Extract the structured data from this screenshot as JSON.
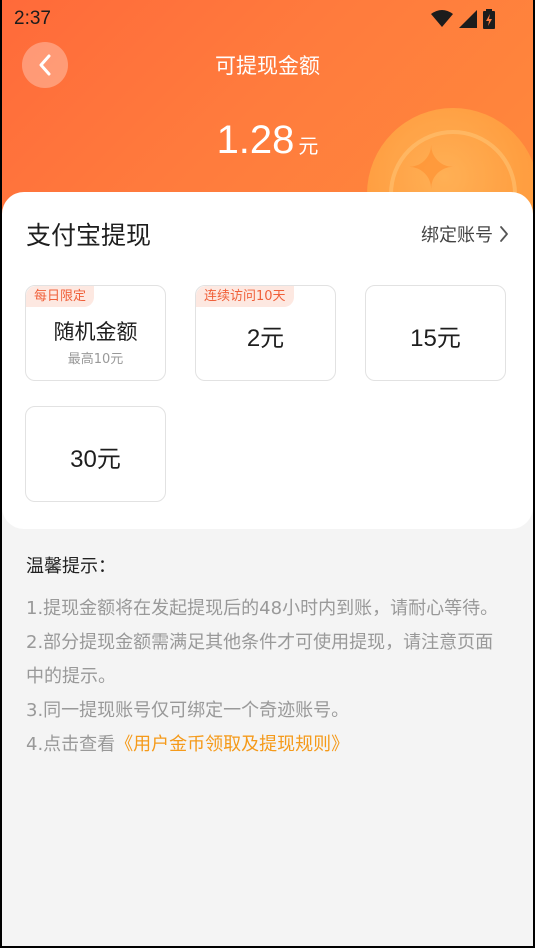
{
  "status_bar": {
    "time": "2:37",
    "icons": [
      "wifi-icon",
      "signal-icon",
      "battery-charging-icon"
    ]
  },
  "header": {
    "title": "可提现金额",
    "amount": "1.28",
    "amount_unit": "元"
  },
  "card": {
    "title": "支付宝提现",
    "bind_link": "绑定账号",
    "options": [
      {
        "tag": "每日限定",
        "label": "随机金额",
        "sub": "最高10元"
      },
      {
        "tag": "连续访问10天",
        "label": "2元",
        "sub": ""
      },
      {
        "tag": "",
        "label": "15元",
        "sub": ""
      },
      {
        "tag": "",
        "label": "30元",
        "sub": ""
      }
    ]
  },
  "tips": {
    "title": "温馨提示：",
    "items": [
      "1.提现金额将在发起提现后的48小时内到账，请耐心等待。",
      "2.部分提现金额需满足其他条件才可使用提现，请注意页面中的提示。",
      "3.同一提现账号仅可绑定一个奇迹账号。"
    ],
    "item4_prefix": "4.点击查看",
    "item4_link": "《用户金币领取及提现规则》"
  },
  "colors": {
    "header_gradient_start": "#ff6a3a",
    "header_gradient_end": "#ff8a3c",
    "tag_bg": "#fde8e1",
    "tag_text": "#f0603a",
    "link": "#f59a1a"
  }
}
